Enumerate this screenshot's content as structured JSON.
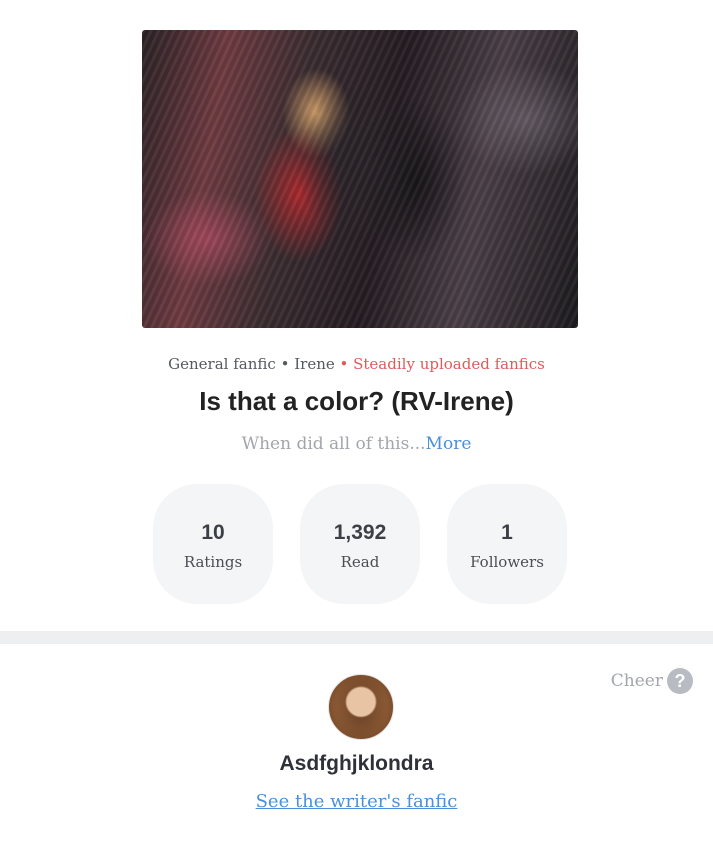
{
  "cover": {
    "alt": "Cover image"
  },
  "meta": {
    "genre": "General fanfic",
    "separator": "•",
    "character": "Irene",
    "status": "• Steadily uploaded fanfics"
  },
  "story": {
    "title": "Is that a color? (RV-Irene)",
    "description": "When did all of this...",
    "more_label": "More"
  },
  "stats": [
    {
      "value": "10",
      "label": "Ratings"
    },
    {
      "value": "1,392",
      "label": "Read"
    },
    {
      "value": "1",
      "label": "Followers"
    }
  ],
  "cheer": {
    "label": "Cheer",
    "help_glyph": "?"
  },
  "author": {
    "name": "Asdfghjklondra",
    "link_label": "See the writer's fanfic"
  }
}
